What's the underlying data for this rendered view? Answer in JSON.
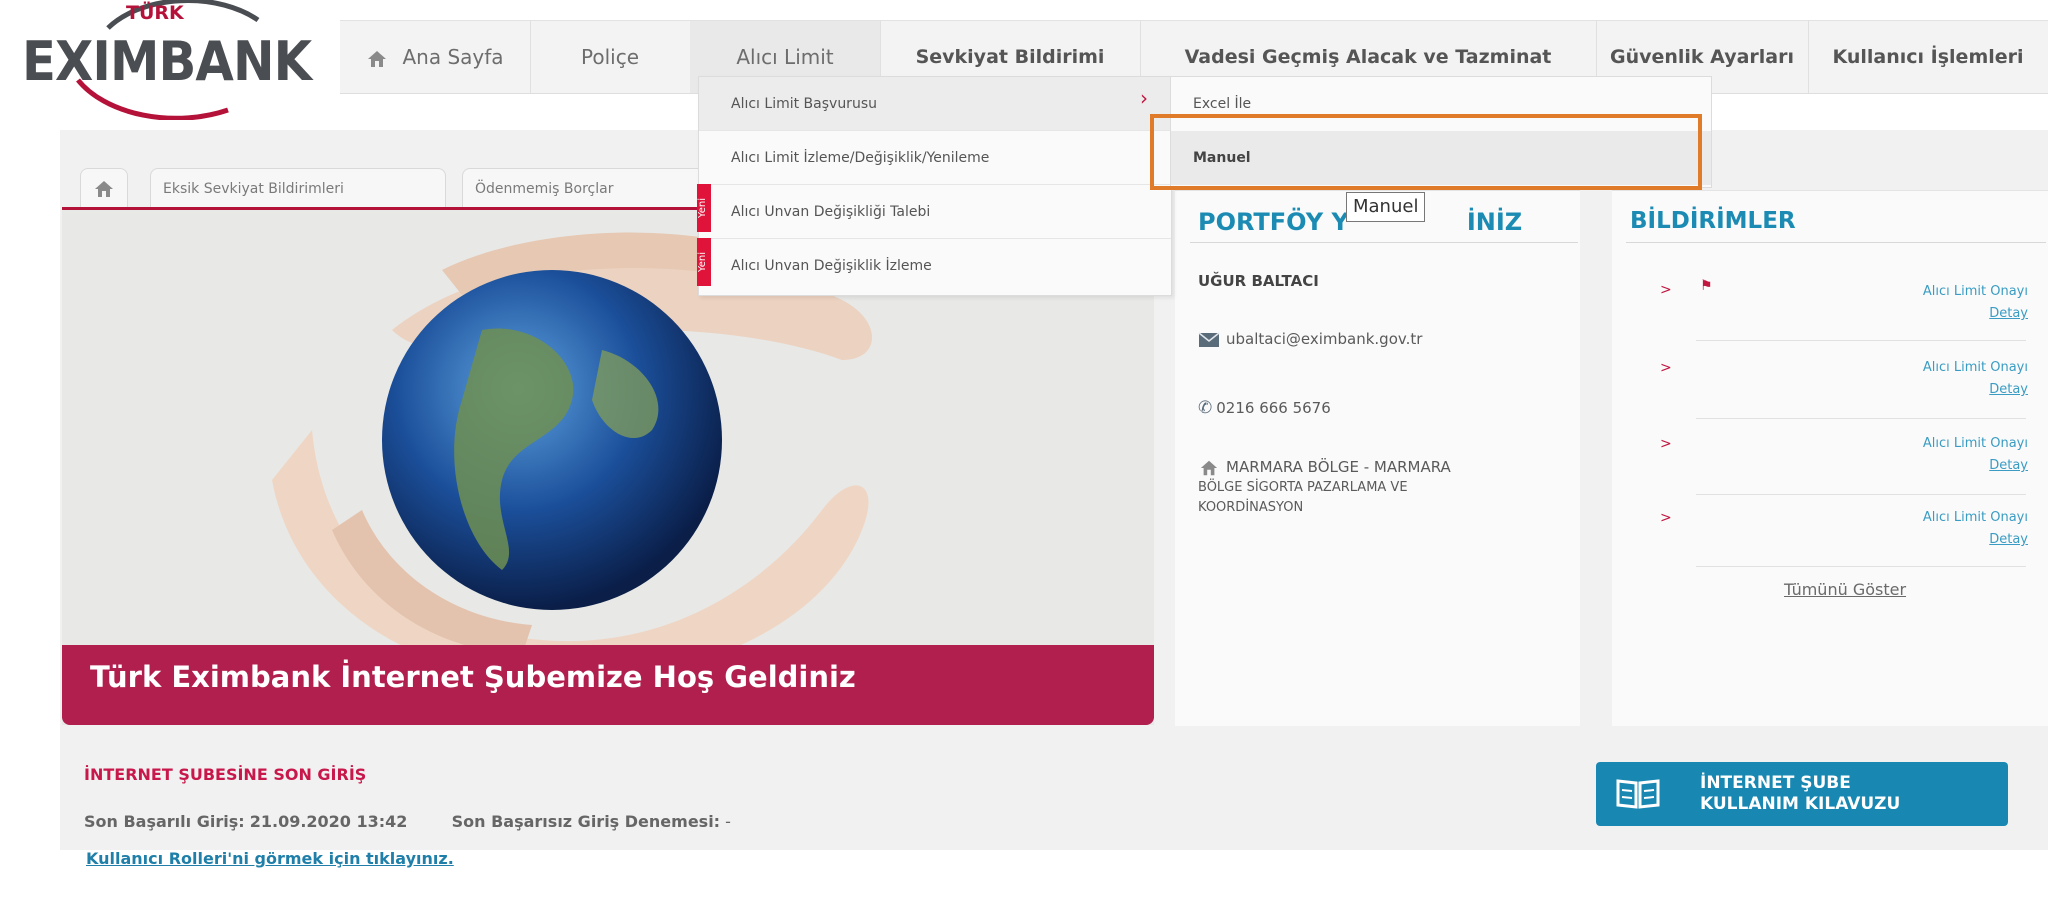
{
  "brand": {
    "turk": "TÜRK",
    "word": "EXIMBANK",
    "accent": "#b5123a"
  },
  "nav": {
    "home_label": "Ana Sayfa",
    "items": [
      "Poliçe",
      "Alıcı Limit",
      "Sevkiyat Bildirimi",
      "Vadesi Geçmiş Alacak ve Tazminat",
      "Güvenlik Ayarları",
      "Kullanıcı İşlemleri"
    ]
  },
  "dropdown": {
    "items": [
      "Alıcı Limit Başvurusu",
      "Alıcı Limit İzleme/Değişiklik/Yenileme",
      "Alıcı Unvan Değişikliği Talebi",
      "Alıcı Unvan Değişiklik İzleme"
    ],
    "submenu": [
      "Excel İle",
      "Manuel"
    ],
    "tooltip": "Manuel",
    "badge": "Yeni"
  },
  "tabs": [
    "Eksik Sevkiyat Bildirimleri",
    "Ödenmemiş Borçlar"
  ],
  "banner": {
    "caption": "Türk Eximbank İnternet Şubemize Hoş Geldiniz"
  },
  "portfolio": {
    "title_left": "PORTFÖY Y",
    "title_right": "İNİZ",
    "name": "UĞUR BALTACI",
    "email": "ubaltaci@eximbank.gov.tr",
    "phone": "0216 666 5676",
    "region_line1": "MARMARA BÖLGE - MARMARA",
    "region_line2": "BÖLGE SİGORTA PAZARLAMA VE",
    "region_line3": "KOORDİNASYON"
  },
  "notifications": {
    "title": "BİLDİRİMLER",
    "items": [
      {
        "title": "Alıcı Limit Onayı",
        "link": "Detay"
      },
      {
        "title": "Alıcı Limit Onayı",
        "link": "Detay"
      },
      {
        "title": "Alıcı Limit Onayı",
        "link": "Detay"
      },
      {
        "title": "Alıcı Limit Onayı",
        "link": "Detay"
      }
    ],
    "show_all": "Tümünü Göster"
  },
  "last_login": {
    "title": "İNTERNET ŞUBESİNE SON GİRİŞ",
    "success_label": "Son Başarılı Giriş:",
    "success_value": "21.09.2020 13:42",
    "fail_label": "Son Başarısız Giriş Denemesi:",
    "fail_value": "-",
    "roles_link": "Kullanıcı Rolleri'ni görmek için tıklayınız."
  },
  "guide": {
    "line1": "İNTERNET ŞUBE",
    "line2": "KULLANIM KILAVUZU"
  },
  "colors": {
    "highlight_box": "#e07b2a",
    "banner_caption": "#b11f4f",
    "link_blue": "#1b8bb3"
  }
}
